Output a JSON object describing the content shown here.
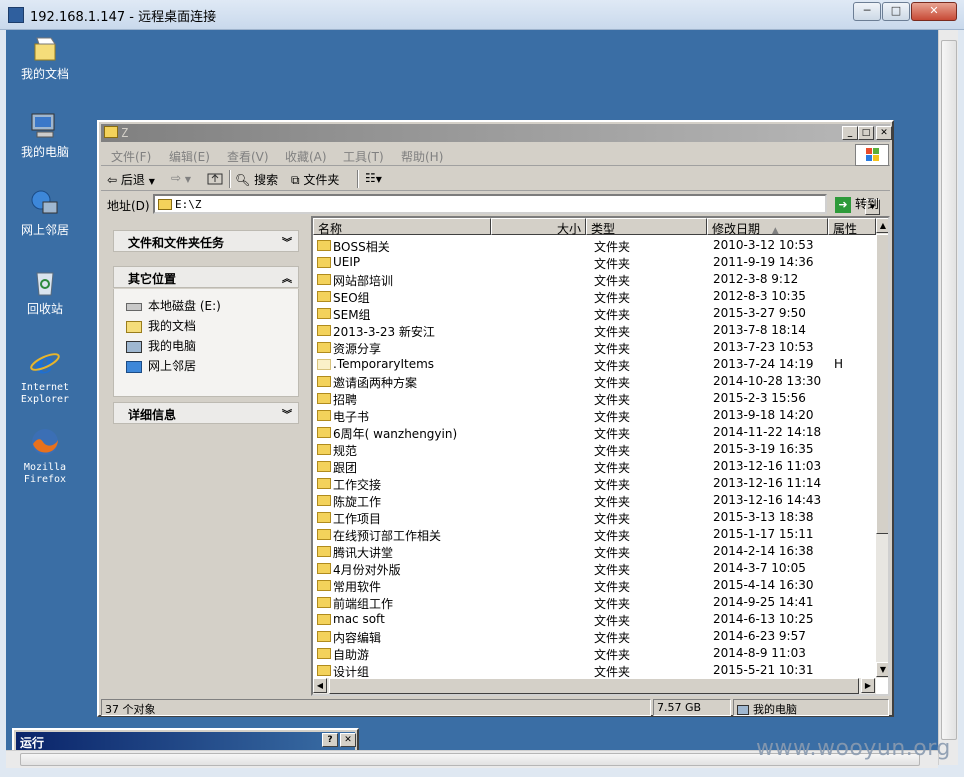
{
  "rdp": {
    "title": "192.168.1.147 - 远程桌面连接",
    "min": "─",
    "max": "□",
    "close": "✕"
  },
  "desktop": {
    "icons": [
      {
        "label": "我的文档",
        "icon": "my-documents-icon"
      },
      {
        "label": "我的电脑",
        "icon": "my-computer-icon"
      },
      {
        "label": "网上邻居",
        "icon": "network-icon"
      },
      {
        "label": "回收站",
        "icon": "recycle-bin-icon"
      },
      {
        "label_1": "Internet",
        "label_2": "Explorer",
        "icon": "internet-explorer-icon"
      },
      {
        "label_1": "Mozilla",
        "label_2": "Firefox",
        "icon": "firefox-icon"
      }
    ]
  },
  "explorer": {
    "title": "Z",
    "menus": [
      "文件(F)",
      "编辑(E)",
      "查看(V)",
      "收藏(A)",
      "工具(T)",
      "帮助(H)"
    ],
    "toolbar": {
      "back": "后退",
      "search": "搜索",
      "folders": "文件夹"
    },
    "address": {
      "label": "地址(D)",
      "value": "E:\\Z",
      "go": "转到"
    },
    "tasks": {
      "file_tasks": "文件和文件夹任务",
      "other_places": "其它位置",
      "details": "详细信息",
      "places": [
        {
          "label": "本地磁盘 (E:)",
          "icon": "drive-icon"
        },
        {
          "label": "我的文档",
          "icon": "my-documents-icon"
        },
        {
          "label": "我的电脑",
          "icon": "my-computer-icon"
        },
        {
          "label": "网上邻居",
          "icon": "network-icon"
        }
      ]
    },
    "columns": {
      "name": "名称",
      "size": "大小",
      "type": "类型",
      "modified": "修改日期",
      "attr": "属性"
    },
    "files": [
      {
        "name": "BOSS相关",
        "type": "文件夹",
        "date": "2010-3-12 10:53",
        "attr": ""
      },
      {
        "name": "UEIP",
        "type": "文件夹",
        "date": "2011-9-19 14:36",
        "attr": ""
      },
      {
        "name": "网站部培训",
        "type": "文件夹",
        "date": "2012-3-8 9:12",
        "attr": ""
      },
      {
        "name": "SEO组",
        "type": "文件夹",
        "date": "2012-8-3 10:35",
        "attr": ""
      },
      {
        "name": "SEM组",
        "type": "文件夹",
        "date": "2015-3-27 9:50",
        "attr": ""
      },
      {
        "name": "2013-3-23 新安江",
        "type": "文件夹",
        "date": "2013-7-8 18:14",
        "attr": ""
      },
      {
        "name": "资源分享",
        "type": "文件夹",
        "date": "2013-7-23 10:53",
        "attr": ""
      },
      {
        "name": ".TemporaryItems",
        "type": "文件夹",
        "date": "2013-7-24 14:19",
        "attr": "H"
      },
      {
        "name": "邀请函两种方案",
        "type": "文件夹",
        "date": "2014-10-28 13:30",
        "attr": ""
      },
      {
        "name": "招聘",
        "type": "文件夹",
        "date": "2015-2-3 15:56",
        "attr": ""
      },
      {
        "name": "电子书",
        "type": "文件夹",
        "date": "2013-9-18 14:20",
        "attr": ""
      },
      {
        "name": "6周年( wanzhengyin)",
        "type": "文件夹",
        "date": "2014-11-22 14:18",
        "attr": ""
      },
      {
        "name": "规范",
        "type": "文件夹",
        "date": "2015-3-19 16:35",
        "attr": ""
      },
      {
        "name": "跟团",
        "type": "文件夹",
        "date": "2013-12-16 11:03",
        "attr": ""
      },
      {
        "name": "工作交接",
        "type": "文件夹",
        "date": "2013-12-16 11:14",
        "attr": ""
      },
      {
        "name": "陈旋工作",
        "type": "文件夹",
        "date": "2013-12-16 14:43",
        "attr": ""
      },
      {
        "name": "工作项目",
        "type": "文件夹",
        "date": "2015-3-13 18:38",
        "attr": ""
      },
      {
        "name": "在线预订部工作相关",
        "type": "文件夹",
        "date": "2015-1-17 15:11",
        "attr": ""
      },
      {
        "name": "腾讯大讲堂",
        "type": "文件夹",
        "date": "2014-2-14 16:38",
        "attr": ""
      },
      {
        "name": "4月份对外版",
        "type": "文件夹",
        "date": "2014-3-7 10:05",
        "attr": ""
      },
      {
        "name": "常用软件",
        "type": "文件夹",
        "date": "2015-4-14 16:30",
        "attr": ""
      },
      {
        "name": "前端组工作",
        "type": "文件夹",
        "date": "2014-9-25 14:41",
        "attr": ""
      },
      {
        "name": "mac soft",
        "type": "文件夹",
        "date": "2014-6-13 10:25",
        "attr": ""
      },
      {
        "name": "内容编辑",
        "type": "文件夹",
        "date": "2014-6-23 9:57",
        "attr": ""
      },
      {
        "name": "自助游",
        "type": "文件夹",
        "date": "2014-8-9 11:03",
        "attr": ""
      },
      {
        "name": "设计组",
        "type": "文件夹",
        "date": "2015-5-21 10:31",
        "attr": ""
      }
    ],
    "status": {
      "count": "37 个对象",
      "size": "7.57 GB",
      "location": "我的电脑"
    }
  },
  "run_dialog": {
    "title": "运行",
    "help": "?",
    "close": "✕"
  },
  "watermark": "www.wooyun.org"
}
